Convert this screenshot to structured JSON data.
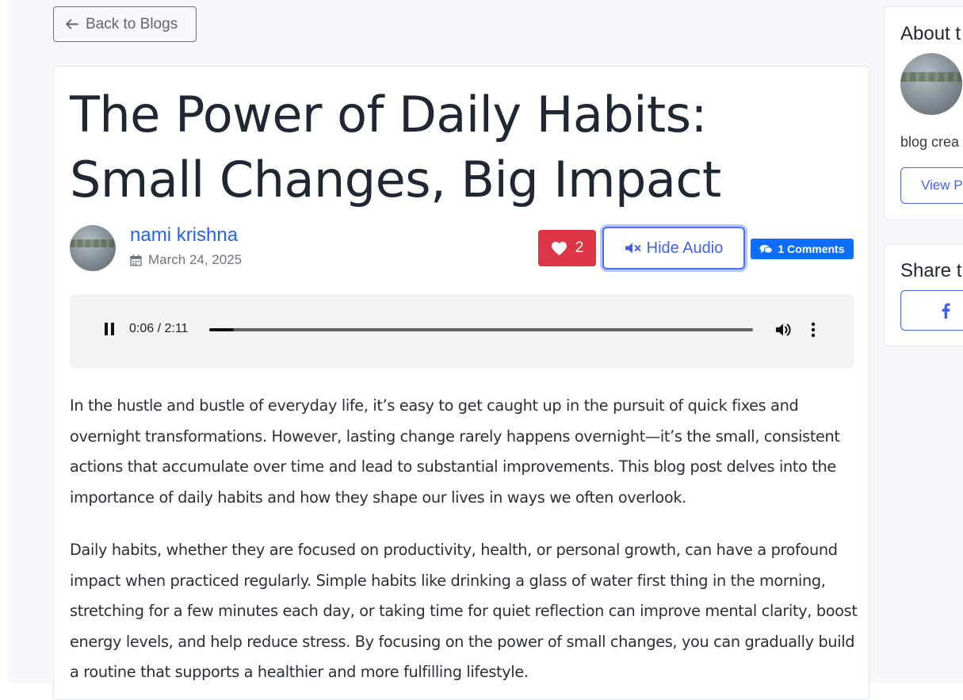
{
  "nav": {
    "back_label": "Back to Blogs"
  },
  "post": {
    "title": "The Power of Daily Habits: Small Changes, Big Impact",
    "author": "nami krishna",
    "date": "March 24, 2025",
    "likes": "2",
    "audio_toggle_label": "Hide Audio",
    "comments_label": "1 Comments",
    "paragraphs": [
      "In the hustle and bustle of everyday life, it’s easy to get caught up in the pursuit of quick fixes and overnight transformations. However, lasting change rarely happens overnight—it’s the small, consistent actions that accumulate over time and lead to substantial improvements. This blog post delves into the importance of daily habits and how they shape our lives in ways we often overlook.",
      "Daily habits, whether they are focused on productivity, health, or personal growth, can have a profound impact when practiced regularly. Simple habits like drinking a glass of water first thing in the morning, stretching for a few minutes each day, or taking time for quiet reflection can improve mental clarity, boost energy levels, and help reduce stress. By focusing on the power of small changes, you can gradually build a routine that supports a healthier and more fulfilling lifestyle."
    ]
  },
  "player": {
    "time": "0:06 / 2:11",
    "progress_fraction": 0.0458,
    "state": "playing"
  },
  "sidebar": {
    "about_title": "About t",
    "bio": "blog crea",
    "view_profile_label": "View P",
    "share_title": "Share t"
  },
  "icons": {
    "back": "arrow-left-icon",
    "calendar": "calendar-icon",
    "like": "heart-icon",
    "audio": "volume-mute-icon",
    "comments": "comments-icon",
    "pause": "pause-icon",
    "volume": "volume-icon",
    "more": "more-vertical-icon",
    "share": "facebook-icon"
  },
  "colors": {
    "link_blue": "#2563eb",
    "like_red": "#dc3545",
    "accent_blue": "#4361ee",
    "badge_blue": "#0d6efd"
  }
}
